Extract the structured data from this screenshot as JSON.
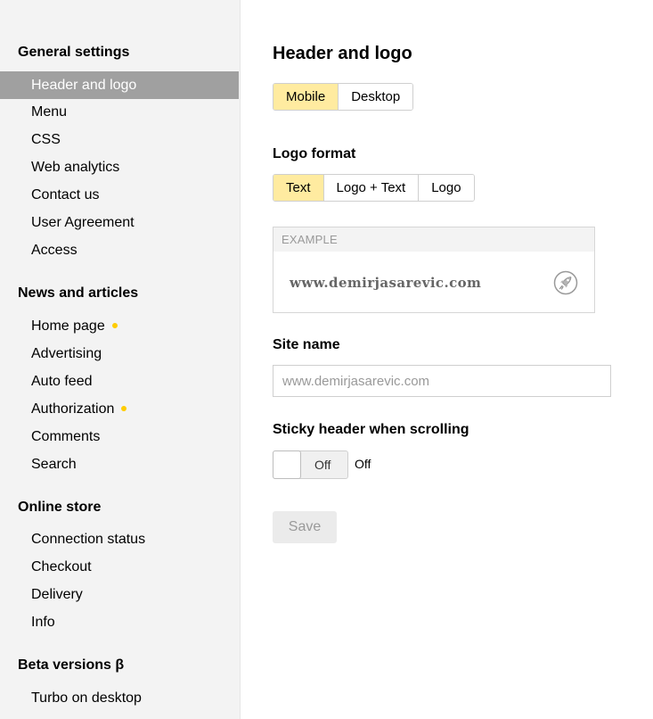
{
  "sidebar": {
    "sections": [
      {
        "title": "General settings",
        "items": [
          {
            "label": "Header and logo"
          },
          {
            "label": "Menu"
          },
          {
            "label": "CSS"
          },
          {
            "label": "Web analytics"
          },
          {
            "label": "Contact us"
          },
          {
            "label": "User Agreement"
          },
          {
            "label": "Access"
          }
        ]
      },
      {
        "title": "News and articles",
        "items": [
          {
            "label": "Home page"
          },
          {
            "label": "Advertising"
          },
          {
            "label": "Auto feed"
          },
          {
            "label": "Authorization"
          },
          {
            "label": "Comments"
          },
          {
            "label": "Search"
          }
        ]
      },
      {
        "title": "Online store",
        "items": [
          {
            "label": "Connection status"
          },
          {
            "label": "Checkout"
          },
          {
            "label": "Delivery"
          },
          {
            "label": "Info"
          }
        ]
      },
      {
        "title": "Beta versions β",
        "items": [
          {
            "label": "Turbo on desktop"
          }
        ]
      }
    ],
    "active_item": "Header and logo",
    "dot_color": "#ffcc00",
    "active_bg": "#a0a0a0"
  },
  "main": {
    "title": "Header and logo",
    "device_tabs": [
      {
        "label": "Mobile",
        "selected": true
      },
      {
        "label": "Desktop",
        "selected": false
      }
    ],
    "logo_format": {
      "label": "Logo format",
      "options": [
        {
          "label": "Text",
          "selected": true
        },
        {
          "label": "Logo + Text",
          "selected": false
        },
        {
          "label": "Logo",
          "selected": false
        }
      ]
    },
    "example": {
      "heading": "EXAMPLE",
      "site_text": "www.demirjasarevic.com",
      "icon": "rocket-icon"
    },
    "site_name": {
      "label": "Site name",
      "placeholder": "www.demirjasarevic.com",
      "value": ""
    },
    "sticky_header": {
      "label": "Sticky header when scrolling",
      "toggle_text": "Off",
      "status": "Off"
    },
    "save_label": "Save",
    "accent_color": "#ffeba0"
  }
}
